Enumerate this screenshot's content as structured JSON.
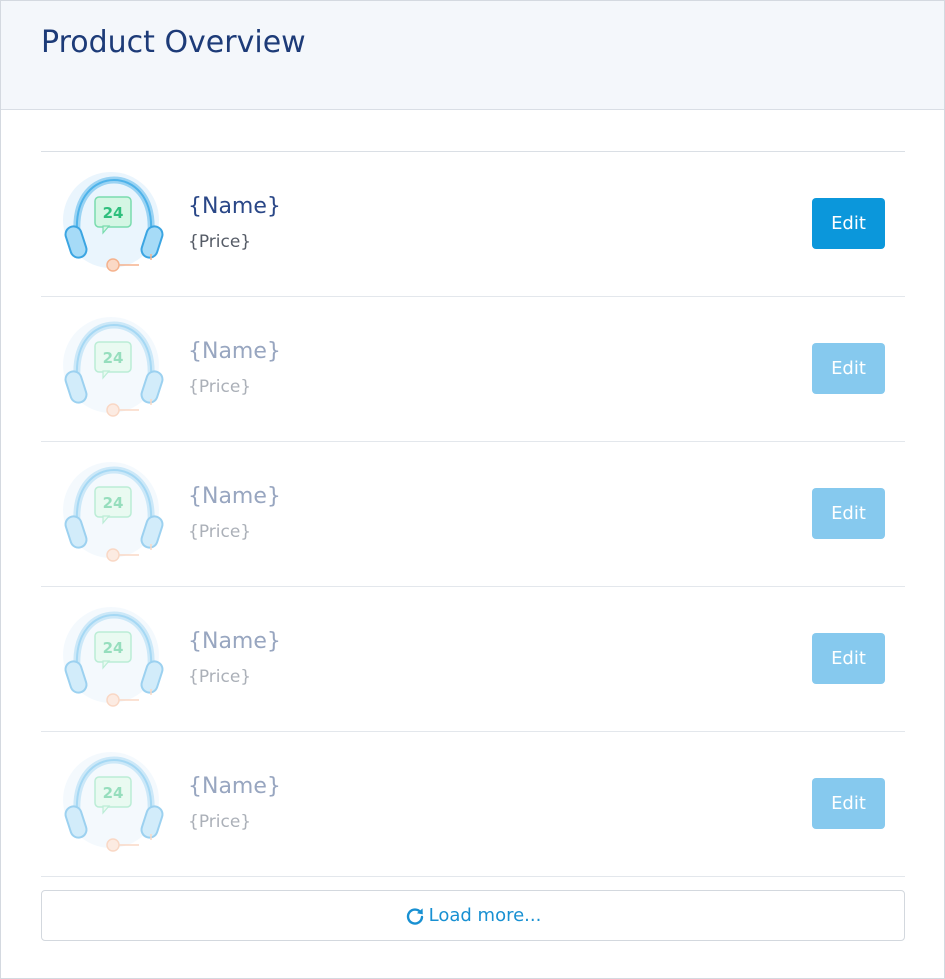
{
  "header": {
    "title": "Product Overview"
  },
  "products": [
    {
      "name": "{Name}",
      "price": "{Price}",
      "edit_label": "Edit",
      "image_icon": "headset-support-24-icon",
      "state": "active"
    },
    {
      "name": "{Name}",
      "price": "{Price}",
      "edit_label": "Edit",
      "image_icon": "headset-support-24-icon",
      "state": "faded"
    },
    {
      "name": "{Name}",
      "price": "{Price}",
      "edit_label": "Edit",
      "image_icon": "headset-support-24-icon",
      "state": "faded"
    },
    {
      "name": "{Name}",
      "price": "{Price}",
      "edit_label": "Edit",
      "image_icon": "headset-support-24-icon",
      "state": "faded"
    },
    {
      "name": "{Name}",
      "price": "{Price}",
      "edit_label": "Edit",
      "image_icon": "headset-support-24-icon",
      "state": "faded"
    }
  ],
  "thumbnail_badge": "24",
  "load_more": {
    "label": "Load more...",
    "icon": "refresh-icon"
  },
  "colors": {
    "title": "#1d3b78",
    "edit_active": "#0b97db",
    "edit_faded": "#86c9ee",
    "link": "#1890d2",
    "header_bg": "#f4f7fb"
  }
}
